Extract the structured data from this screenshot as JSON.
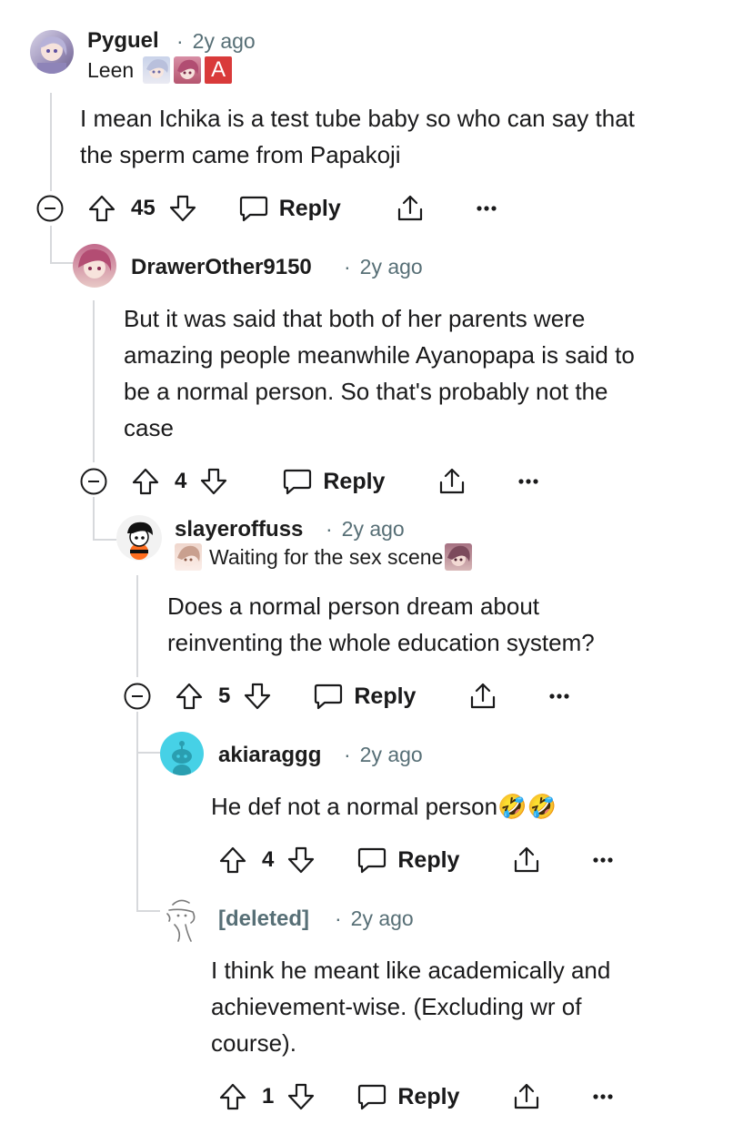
{
  "comments": [
    {
      "username": "Pyguel",
      "age": "2y ago",
      "flair": "Leen",
      "flair_badge": "A",
      "body_lines": [
        "I mean Ichika is a test tube baby so who can say that",
        "the sperm came from Papakoji"
      ],
      "votes": "45",
      "reply_label": "Reply",
      "avatar_icon": "anime-avatar-icon"
    },
    {
      "username": "DrawerOther9150",
      "age": "2y ago",
      "body_lines": [
        "But it was said that both of her parents were",
        "amazing people meanwhile Ayanopapa is said to",
        "be a normal person. So that's probably not the",
        "case"
      ],
      "votes": "4",
      "reply_label": "Reply",
      "avatar_icon": "anime-avatar-icon"
    },
    {
      "username": "slayeroffuss",
      "age": "2y ago",
      "flair": "Waiting for the sex scene",
      "body_lines": [
        "Does a normal person dream about",
        "reinventing the whole education system?"
      ],
      "votes": "5",
      "reply_label": "Reply",
      "avatar_icon": "snoo-avatar-icon"
    },
    {
      "username": "akiaraggg",
      "age": "2y ago",
      "body_lines": [
        "He def not a normal person🤣🤣"
      ],
      "votes": "4",
      "reply_label": "Reply",
      "avatar_icon": "default-snoo-icon"
    },
    {
      "username": "[deleted]",
      "age": "2y ago",
      "body_lines": [
        "I think he meant like academically and",
        "achievement-wise. (Excluding wr of",
        "course)."
      ],
      "votes": "1",
      "reply_label": "Reply",
      "avatar_icon": "deleted-user-icon"
    }
  ],
  "colors": {
    "text": "#1a1a1b",
    "meta": "#576f76",
    "thread_line": "#d7d9dc",
    "akiaraggg_avatar": "#46d1e6",
    "badge_red": "#d93a3a"
  }
}
